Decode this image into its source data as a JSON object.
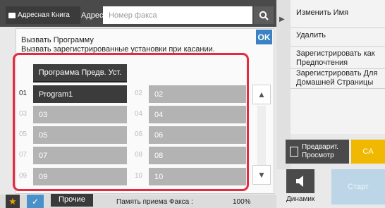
{
  "header": {
    "tab_address_book": "Адресная Книга",
    "tab_address": "Адрес",
    "fax_placeholder": "Номер факса"
  },
  "right_menu": {
    "items": [
      {
        "label": "Изменить Имя"
      },
      {
        "label": "Удалить"
      },
      {
        "label": "Зарегистрировать как Предпочтения"
      },
      {
        "label": "Зарегистрировать Для Домашней Страницы"
      }
    ]
  },
  "actions": {
    "preview": "Предварит. Просмотр",
    "ca": "CA",
    "speaker": "Динамик",
    "start": "Старт"
  },
  "dialog": {
    "title": "Вызвать Программу",
    "subtitle": "Вызвать зарегистрированные установки при касании.",
    "ok": "OK",
    "program_button": "Программа Предв. Уст.",
    "slots": [
      {
        "num": "01",
        "label": "Program1",
        "active": true
      },
      {
        "num": "02",
        "label": "02",
        "active": false
      },
      {
        "num": "03",
        "label": "03",
        "active": false
      },
      {
        "num": "04",
        "label": "04",
        "active": false
      },
      {
        "num": "05",
        "label": "05",
        "active": false
      },
      {
        "num": "06",
        "label": "06",
        "active": false
      },
      {
        "num": "07",
        "label": "07",
        "active": false
      },
      {
        "num": "08",
        "label": "08",
        "active": false
      },
      {
        "num": "09",
        "label": "09",
        "active": false
      },
      {
        "num": "10",
        "label": "10",
        "active": false
      }
    ]
  },
  "footer": {
    "other": "Прочие",
    "memory_label": "Память приема Факса :",
    "memory_value": "100%"
  },
  "colors": {
    "accent": "#3b82c4",
    "highlight_frame": "#e8283d",
    "ca": "#f0b800",
    "start": "#bcd6e8"
  }
}
